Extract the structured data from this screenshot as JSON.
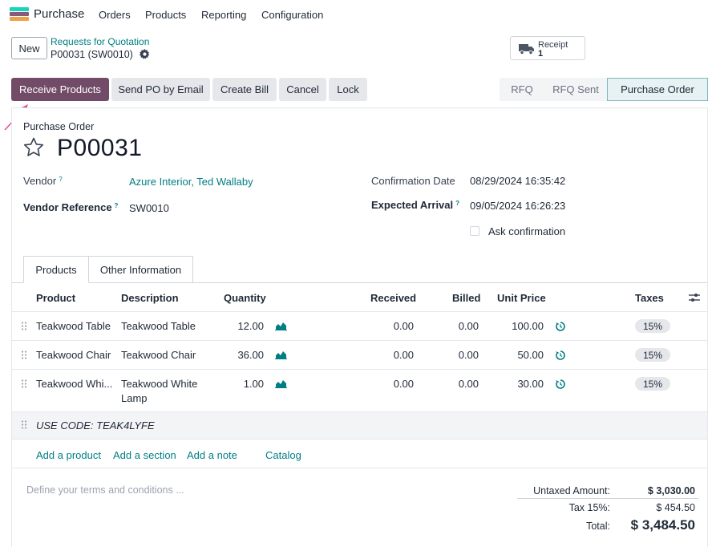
{
  "app": {
    "name": "Purchase"
  },
  "menu": [
    "Orders",
    "Products",
    "Reporting",
    "Configuration"
  ],
  "control": {
    "new_label": "New",
    "breadcrumb": "Requests for Quotation",
    "record": "P00031 (SW0010)"
  },
  "smart_button": {
    "label": "Receipt",
    "value": "1"
  },
  "actions": [
    "Receive Products",
    "Send PO by Email",
    "Create Bill",
    "Cancel",
    "Lock"
  ],
  "status": {
    "steps": [
      "RFQ",
      "RFQ Sent",
      "Purchase Order"
    ],
    "active": "Purchase Order"
  },
  "form": {
    "type_label": "Purchase Order",
    "name": "P00031",
    "vendor_label": "Vendor",
    "vendor_value": "Azure Interior, Ted Wallaby",
    "vendor_ref_label": "Vendor Reference",
    "vendor_ref_value": "SW0010",
    "confirmation_label": "Confirmation Date",
    "confirmation_value": "08/29/2024 16:35:42",
    "expected_label": "Expected Arrival",
    "expected_value": "09/05/2024 16:26:23",
    "ask_confirmation_label": "Ask confirmation",
    "help_mark": "?"
  },
  "tabs": [
    "Products",
    "Other Information"
  ],
  "table": {
    "headers": {
      "product": "Product",
      "description": "Description",
      "quantity": "Quantity",
      "received": "Received",
      "billed": "Billed",
      "unit_price": "Unit Price",
      "taxes": "Taxes"
    },
    "rows": [
      {
        "product": "Teakwood Table",
        "description": "Teakwood Table",
        "description2": "",
        "quantity": "12.00",
        "received": "0.00",
        "billed": "0.00",
        "unit_price": "100.00",
        "tax": "15%"
      },
      {
        "product": "Teakwood Chair",
        "description": "Teakwood Chair",
        "description2": "",
        "quantity": "36.00",
        "received": "0.00",
        "billed": "0.00",
        "unit_price": "50.00",
        "tax": "15%"
      },
      {
        "product": "Teakwood Whi...",
        "description": "Teakwood White",
        "description2": "Lamp",
        "quantity": "1.00",
        "received": "0.00",
        "billed": "0.00",
        "unit_price": "30.00",
        "tax": "15%"
      }
    ],
    "note": "USE CODE: TEAK4LYFE"
  },
  "add_links": [
    "Add a product",
    "Add a section",
    "Add a note",
    "Catalog"
  ],
  "terms_placeholder": "Define your terms and conditions ...",
  "totals": {
    "untaxed_label": "Untaxed Amount:",
    "untaxed_value": "$ 3,030.00",
    "tax_label": "Tax 15%:",
    "tax_value": "$ 454.50",
    "total_label": "Total:",
    "total_value": "$ 3,484.50"
  },
  "colors": {
    "primary": "#714b67",
    "link": "#017e84"
  }
}
